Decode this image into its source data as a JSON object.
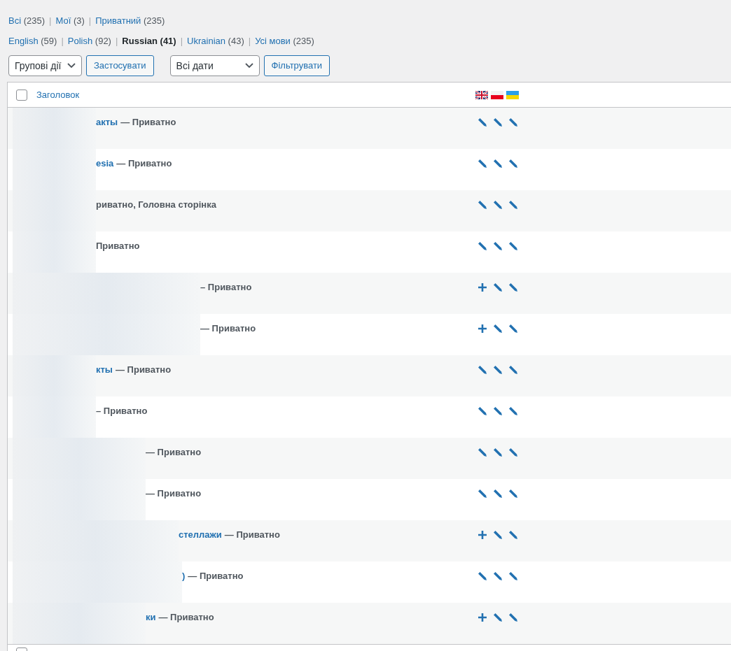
{
  "status_filters": [
    {
      "label": "Всі",
      "count": "(235)",
      "selected": false
    },
    {
      "separator": "|",
      "label": "Мої",
      "count": "(3)",
      "selected": false
    },
    {
      "separator": "|",
      "label": "Приватний",
      "count": "(235)",
      "selected": false
    }
  ],
  "language_filters": [
    {
      "label": "English",
      "count": "(59)",
      "selected": false
    },
    {
      "separator": "|",
      "label": "Polish",
      "count": "(92)",
      "selected": false
    },
    {
      "separator": "|",
      "label": "Russian",
      "count": "(41)",
      "selected": true
    },
    {
      "separator": "|",
      "label": "Ukrainian",
      "count": "(43)",
      "selected": false
    },
    {
      "separator": "|",
      "label": "Усі мови",
      "count": "(235)",
      "selected": false
    }
  ],
  "bulk_actions": {
    "value": "Групові дії",
    "button": "Застосувати"
  },
  "date_filter": {
    "value": "Всі дати",
    "button": "Фільтрувати"
  },
  "table": {
    "header": {
      "title": "Заголовок",
      "checked": false,
      "flags": [
        {
          "kind": "gb"
        },
        {
          "kind": "pl"
        },
        {
          "kind": "ua"
        }
      ]
    },
    "rows": [
      {
        "title_fragment": "акты",
        "state": "— Приватно",
        "translations": [
          {
            "kind": "edit"
          },
          {
            "kind": "edit"
          },
          {
            "kind": "edit"
          }
        ]
      },
      {
        "title_fragment": "esia",
        "state": "— Приватно",
        "translations": [
          {
            "kind": "edit"
          },
          {
            "kind": "edit"
          },
          {
            "kind": "edit"
          }
        ]
      },
      {
        "state": "риватно, Головна сторінка",
        "translations": [
          {
            "kind": "edit"
          },
          {
            "kind": "edit"
          },
          {
            "kind": "edit"
          }
        ]
      },
      {
        "state": "Приватно",
        "translations": [
          {
            "kind": "edit"
          },
          {
            "kind": "edit"
          },
          {
            "kind": "edit"
          }
        ]
      },
      {
        "state": "– Приватно",
        "translations": [
          {
            "kind": "add"
          },
          {
            "kind": "edit"
          },
          {
            "kind": "edit"
          }
        ]
      },
      {
        "state": "— Приватно",
        "translations": [
          {
            "kind": "add"
          },
          {
            "kind": "edit"
          },
          {
            "kind": "edit"
          }
        ]
      },
      {
        "title_fragment": "кты",
        "state": "— Приватно",
        "translations": [
          {
            "kind": "edit"
          },
          {
            "kind": "edit"
          },
          {
            "kind": "edit"
          }
        ]
      },
      {
        "state": "– Приватно",
        "translations": [
          {
            "kind": "edit"
          },
          {
            "kind": "edit"
          },
          {
            "kind": "edit"
          }
        ]
      },
      {
        "state": "— Приватно",
        "translations": [
          {
            "kind": "edit"
          },
          {
            "kind": "edit"
          },
          {
            "kind": "edit"
          }
        ]
      },
      {
        "state": "— Приватно",
        "translations": [
          {
            "kind": "edit"
          },
          {
            "kind": "edit"
          },
          {
            "kind": "edit"
          }
        ]
      },
      {
        "title_fragment": "стеллажи",
        "state": "— Приватно",
        "translations": [
          {
            "kind": "add"
          },
          {
            "kind": "edit"
          },
          {
            "kind": "edit"
          }
        ]
      },
      {
        "title_fragment": ")",
        "state": "— Приватно",
        "translations": [
          {
            "kind": "edit"
          },
          {
            "kind": "edit"
          },
          {
            "kind": "edit"
          }
        ]
      },
      {
        "title_fragment": "ки",
        "state": "— Приватно",
        "translations": [
          {
            "kind": "add"
          },
          {
            "kind": "edit"
          },
          {
            "kind": "edit"
          }
        ]
      }
    ],
    "footer": {
      "checked": false
    }
  }
}
